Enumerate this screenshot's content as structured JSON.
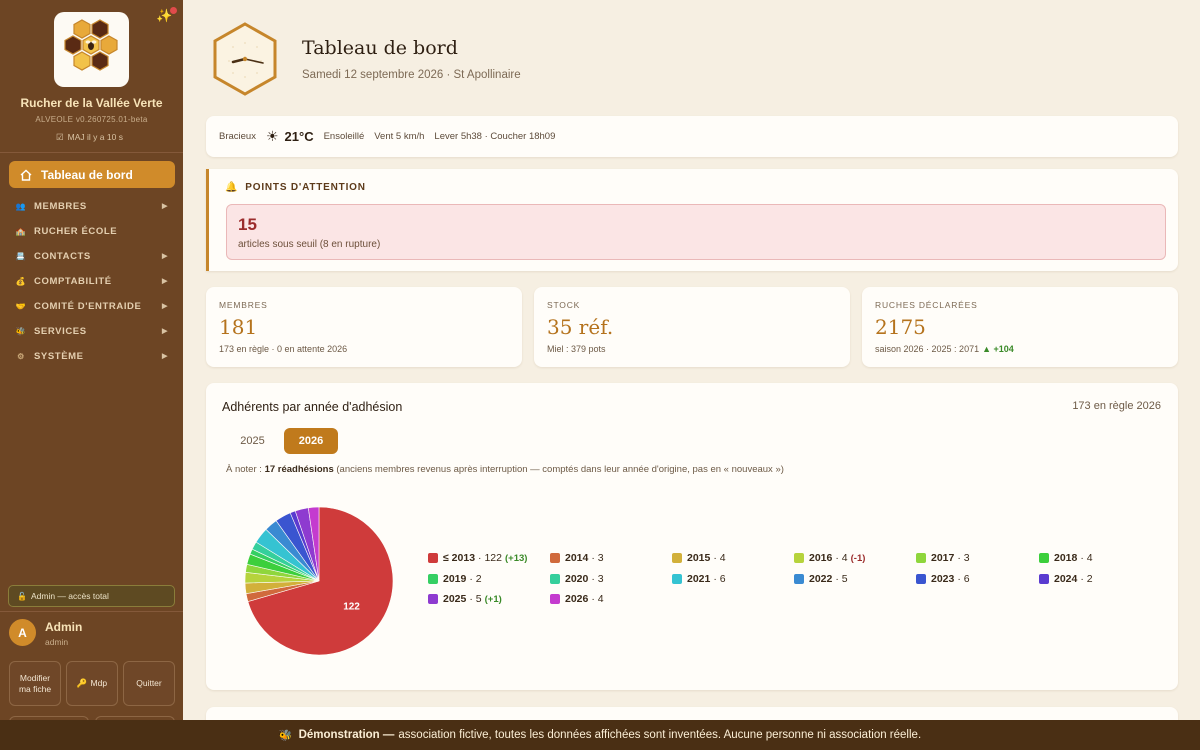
{
  "sidebar": {
    "org_name": "Rucher de la Vallée Verte",
    "version": "ALVEOLE v0.260725.01-beta",
    "update_status": "MAJ il y a 10 s",
    "active_item": "Tableau de bord",
    "items": [
      {
        "label": "MEMBRES",
        "icon": "people-icon",
        "has_children": true
      },
      {
        "label": "RUCHER ÉCOLE",
        "icon": "school-icon",
        "has_children": false
      },
      {
        "label": "CONTACTS",
        "icon": "contacts-icon",
        "has_children": true
      },
      {
        "label": "COMPTABILITÉ",
        "icon": "accounting-icon",
        "has_children": true
      },
      {
        "label": "COMITÉ D'ENTRAIDE",
        "icon": "handshake-icon",
        "has_children": true
      },
      {
        "label": "SERVICES",
        "icon": "services-icon",
        "has_children": true
      },
      {
        "label": "SYSTÈME",
        "icon": "gear-icon",
        "has_children": true
      }
    ],
    "admin_badge": "Admin — accès total",
    "user": {
      "initial": "A",
      "name": "Admin",
      "role": "admin"
    },
    "buttons": {
      "edit_profile": "Modifier ma fiche",
      "password": "Mdp",
      "quit": "Quitter"
    }
  },
  "header": {
    "title": "Tableau de bord",
    "subtitle": "Samedi 12 septembre 2026 · St Apollinaire"
  },
  "weather": {
    "label": "Bracieux",
    "temperature": "21°C",
    "condition": "Ensoleillé",
    "wind": "Vent 5 km/h",
    "sun": "Lever 5h38 · Coucher 18h09"
  },
  "attention": {
    "title": "POINTS D'ATTENTION",
    "count": "15",
    "text": "articles sous seuil (8 en rupture)"
  },
  "stats": [
    {
      "label": "MEMBRES",
      "value": "181",
      "note": "173 en règle · 0 en attente 2026",
      "delta": ""
    },
    {
      "label": "STOCK",
      "value": "35 réf.",
      "note": "Miel : 379 pots",
      "delta": ""
    },
    {
      "label": "RUCHES DÉCLARÉES",
      "value": "2175",
      "note": "saison 2026 · 2025 : 2071",
      "delta": "▲ +104"
    }
  ],
  "chart_card": {
    "title": "Adhérents par année d'adhésion",
    "right_label": "173 en règle 2026",
    "tabs": [
      "2025",
      "2026"
    ],
    "active_tab": "2026",
    "note_prefix": "À noter : ",
    "note_bold": "17 réadhésions",
    "note_suffix": " (anciens membres revenus après interruption — comptés dans leur année d'origine, pas en « nouveaux »)",
    "pie_label": "122"
  },
  "chart_data": {
    "type": "pie",
    "title": "Adhérents par année d'adhésion",
    "slices": [
      {
        "label": "≤ 2013",
        "value": 122,
        "delta": "(+13)",
        "color": "#cf3b3b"
      },
      {
        "label": "2014",
        "value": 3,
        "delta": "",
        "color": "#d06a3c"
      },
      {
        "label": "2015",
        "value": 4,
        "delta": "",
        "color": "#d2b03a"
      },
      {
        "label": "2016",
        "value": 4,
        "delta": "(-1)",
        "color": "#b6d33c"
      },
      {
        "label": "2017",
        "value": 3,
        "delta": "",
        "color": "#8fd63c"
      },
      {
        "label": "2018",
        "value": 4,
        "delta": "",
        "color": "#3ccf3c"
      },
      {
        "label": "2019",
        "value": 2,
        "delta": "",
        "color": "#35cf63"
      },
      {
        "label": "2020",
        "value": 3,
        "delta": "",
        "color": "#35cf9c"
      },
      {
        "label": "2021",
        "value": 6,
        "delta": "",
        "color": "#35c3d2"
      },
      {
        "label": "2022",
        "value": 5,
        "delta": "",
        "color": "#3a8ad2"
      },
      {
        "label": "2023",
        "value": 6,
        "delta": "",
        "color": "#3a55d0"
      },
      {
        "label": "2024",
        "value": 2,
        "delta": "",
        "color": "#5a3bd0"
      },
      {
        "label": "2025",
        "value": 5,
        "delta": "(+1)",
        "color": "#8e3bd0"
      },
      {
        "label": "2026",
        "value": 4,
        "delta": "",
        "color": "#c43bcf"
      }
    ]
  },
  "footer": {
    "bold": "Démonstration —",
    "text": "association fictive, toutes les données affichées sont inventées. Aucune personne ni association réelle."
  }
}
